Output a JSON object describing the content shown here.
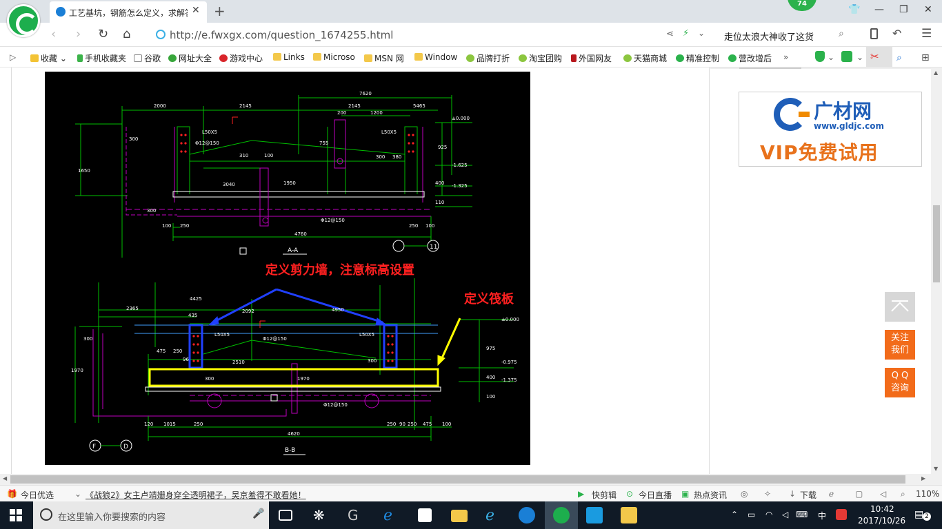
{
  "browser": {
    "tab_title": "工艺基坑，钢筋怎么定义，求解答",
    "badge_count": "74",
    "url": "http://e.fwxgx.com/question_1674255.html",
    "search_query": "走位太浪大神收了这货"
  },
  "bookmarks": [
    "收藏",
    "手机收藏夹",
    "谷歌",
    "网址大全",
    "游戏中心",
    "Links",
    "Microso",
    "MSN 网",
    "Window",
    "品牌打折",
    "淘宝团购",
    "外国网友",
    "天猫商城",
    "精准控制",
    "营改增后"
  ],
  "drawing": {
    "top": {
      "dims_top": [
        "2000",
        "2145",
        "2145",
        "5465",
        "7620",
        "200",
        "1200"
      ],
      "labels": [
        "L50X5",
        "L50X5",
        "Φ12@150",
        "300",
        "310",
        "380",
        "300",
        "100",
        "755",
        "925",
        "1650",
        "3040",
        "1950",
        "400",
        "110",
        "100",
        "250",
        "250",
        "100",
        "4760",
        "±0.000",
        "-1.625",
        "-1.325",
        "Φ12@150",
        "300"
      ],
      "section": "A-A",
      "axis": [
        "11"
      ]
    },
    "bottom": {
      "dims_top": [
        "4425",
        "2365",
        "435",
        "2092",
        "4950"
      ],
      "labels": [
        "L50X5",
        "L50X5",
        "Φ12@150",
        "300",
        "475",
        "250",
        "96",
        "2510",
        "1970",
        "300",
        "300",
        "1970",
        "975",
        "400",
        "100",
        "±0.000",
        "-0.975",
        "-1.375",
        "120",
        "1015",
        "250",
        "250",
        "90",
        "250",
        "475",
        "100",
        "4620",
        "Φ12@150"
      ],
      "section": "B-B",
      "axis": [
        "F",
        "D"
      ]
    },
    "annotation_wall": "定义剪力墙，注意标高设置",
    "annotation_slab": "定义筏板"
  },
  "ad": {
    "brand": "广材网",
    "site": "www.gldjc.com",
    "slogan": "VIP免费试用"
  },
  "side_buttons": {
    "follow": "关注我们",
    "qq": "Q Q 咨询"
  },
  "status": {
    "today": "今日优选",
    "news": "《战狼2》女主卢靖姗身穿全透明裙子，吴京羞得不敢看她！",
    "quick_edit": "快剪辑",
    "live": "今日直播",
    "hot": "热点资讯",
    "download": "下载",
    "zoom": "110%"
  },
  "taskbar": {
    "search_placeholder": "在这里输入你要搜索的内容",
    "ime": "中",
    "time": "10:42",
    "date": "2017/10/26",
    "notify_count": "2"
  }
}
